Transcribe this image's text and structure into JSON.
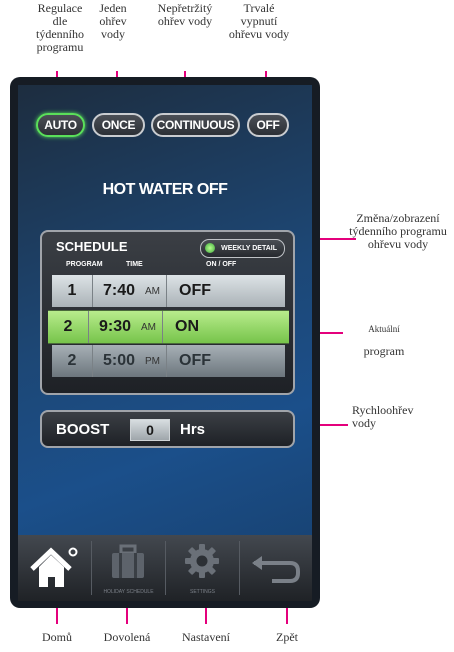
{
  "annotations": {
    "top": {
      "auto": "Regulace dle týdenního programu",
      "once": "Jeden ohřev vody",
      "continuous": "Nepřetržitý ohřev vody",
      "off": "Trvalé vypnutí ohřevu vody"
    },
    "right": {
      "weekly": "Změna/zobrazení týdenního programu ohřevu vody",
      "current_program_1": "Aktuální",
      "current_program_2": "program",
      "boost": "Rychloohřev vody"
    },
    "bottom": {
      "home": "Domů",
      "holiday": "Dovolená",
      "settings": "Nastavení",
      "back": "Zpět"
    }
  },
  "modes": {
    "auto": "AUTO",
    "once": "ONCE",
    "continuous": "CONTINUOUS",
    "off": "OFF",
    "active": "auto"
  },
  "status": "HOT WATER OFF",
  "schedule": {
    "title": "SCHEDULE",
    "weekly_detail": "WEEKLY DETAIL",
    "headers": {
      "program": "PROGRAM",
      "time": "TIME",
      "onoff": "ON / OFF"
    },
    "rows": [
      {
        "program": "1",
        "time": "7:40",
        "ampm": "AM",
        "state": "OFF"
      },
      {
        "program": "2",
        "time": "9:30",
        "ampm": "AM",
        "state": "ON"
      },
      {
        "program": "2",
        "time": "5:00",
        "ampm": "PM",
        "state": "OFF"
      }
    ]
  },
  "boost": {
    "label": "BOOST",
    "value": "0",
    "unit": "Hrs"
  },
  "nav": {
    "holiday": "HOLIDAY SCHEDULE",
    "settings": "SETTINGS"
  },
  "colors": {
    "active_green": "#5ae05a",
    "current_row": "#8ed65c",
    "screen_blue": "#1b4f8a",
    "annotation_line": "#e4007c"
  },
  "icons": {
    "home": "home-icon",
    "holiday": "suitcase-icon",
    "settings": "gear-icon",
    "back": "back-arrow-icon",
    "weekly_led": "led-icon"
  }
}
